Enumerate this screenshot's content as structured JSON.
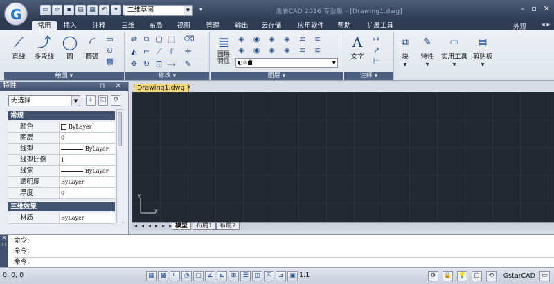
{
  "app": {
    "logo_letter": "G",
    "workspace": "二维草图",
    "title": "浩辰CAD 2016 专业版 - [Drawing1.dwg]"
  },
  "window_buttons": {
    "minimize": "–",
    "restore": "▫",
    "close": "✕"
  },
  "ribbon_tabs": [
    "常用",
    "插入",
    "注释",
    "三维",
    "布局",
    "视图",
    "管理",
    "输出",
    "云存储",
    "应用软件",
    "帮助",
    "扩展工具"
  ],
  "ribbon_right": {
    "appearance": "外观",
    "arrows": "◂ ▸"
  },
  "panels": {
    "draw": {
      "title": "绘图",
      "line": "直线",
      "polyline": "多段线",
      "circle": "圆",
      "arc": "圆弧"
    },
    "modify": {
      "title": "修改"
    },
    "layers": {
      "title": "图层",
      "layer_props": "图层\n特性",
      "combo_value": "0"
    },
    "annotation": {
      "title": "注释",
      "text": "文字"
    },
    "block": {
      "label": "块"
    },
    "properties": {
      "label": "特性"
    },
    "utilities": {
      "label": "实用工具"
    },
    "clipboard": {
      "label": "剪贴板"
    }
  },
  "props_palette": {
    "title": "特性",
    "header_buttons": "⊓ ✕",
    "selection": "无选择",
    "sections": {
      "general": "常规",
      "three_d": "三维效果"
    },
    "general_rows": [
      {
        "key": "颜色",
        "value": "ByLayer"
      },
      {
        "key": "图层",
        "value": "0"
      },
      {
        "key": "线型",
        "value": "ByLayer"
      },
      {
        "key": "线型比例",
        "value": "1"
      },
      {
        "key": "线宽",
        "value": "ByLayer"
      },
      {
        "key": "透明度",
        "value": "ByLayer"
      },
      {
        "key": "厚度",
        "value": "0"
      }
    ],
    "three_d_rows": [
      {
        "key": "材质",
        "value": "ByLayer"
      }
    ]
  },
  "document": {
    "tab": "Drawing1.dwg",
    "close": "✕",
    "ucs_x": "X",
    "ucs_y": "Y",
    "layout_tabs": [
      "模型",
      "布局1",
      "布局2"
    ]
  },
  "command": {
    "lines": [
      "命令:",
      "命令:"
    ],
    "prompt": "命令:"
  },
  "status": {
    "coords": "0, 0, 0",
    "scale": "1:1",
    "brand": "GstarCAD"
  }
}
